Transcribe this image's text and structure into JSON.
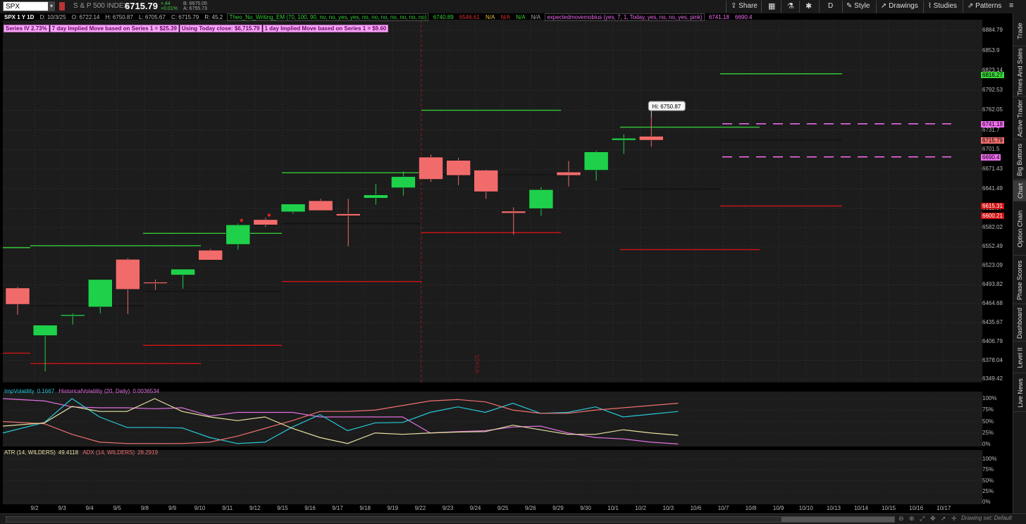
{
  "toolbar": {
    "symbol": "SPX",
    "symbol_name": "S & P 500 INDEX",
    "last_price": "6715.79",
    "change_pts": "+.44",
    "change_pct": "+0.01%",
    "bid": "B: 6675.05",
    "ask": "A: 6755.73",
    "share_label": "Share",
    "aggregation_label": "D",
    "style_label": "Style",
    "drawings_label": "Drawings",
    "studies_label": "Studies",
    "patterns_label": "Patterns"
  },
  "status_line": {
    "title": "SPX 1 Y 1D",
    "date": "D: 10/3/25",
    "open": "O: 6722.14",
    "high": "H: 6750.87",
    "low": "L: 6705.67",
    "close": "C: 6715.79",
    "range": "R: 45.2",
    "study1": "Theo_No_Writing_EM (70, 100, 90, no, no, yes, yes, no, no, no, no, no, no, no)",
    "study1_v1": "6740.89",
    "study1_v2": "6546.61",
    "na1": "N/A",
    "na2": "N/A",
    "na3": "N/A",
    "na4": "N/A",
    "study2": "expectedmovemobius (yes, 7, 1, Today, yes, no, no, yes, pink)",
    "study2_v1": "6741.18",
    "study2_v2": "6690.4"
  },
  "study_labels": {
    "iv": "Series IV 2.73%",
    "seven_day": "7 day Implied Move based on Series 1 = $25.39",
    "close_used": "Using Today close: $6,715.79",
    "one_day": "1 day Implied Move based on Series 1 = $9.60"
  },
  "annotation": {
    "hi_label": "Hi: 6750.87",
    "vline_label": "9/19/25"
  },
  "price_axis": {
    "ticks": [
      "6884.79",
      "6853.9",
      "6823.14",
      "6792.53",
      "6762.05",
      "6731.7",
      "6701.5",
      "6671.43",
      "6641.49",
      "6611.67",
      "6582.02",
      "6552.49",
      "6523.09",
      "6493.82",
      "6464.68",
      "6435.67",
      "6406.79",
      "6378.04",
      "6349.42"
    ],
    "tags": [
      {
        "text": "6816.27",
        "color": "#39d339",
        "fg": "#000"
      },
      {
        "text": "6741.18",
        "color": "#f46ef4",
        "fg": "#000"
      },
      {
        "text": "6715.79",
        "color": "#f07070",
        "fg": "#000"
      },
      {
        "text": "6690.4",
        "color": "#f46ef4",
        "fg": "#000"
      },
      {
        "text": "6615.31",
        "color": "#d01010",
        "fg": "#fff"
      },
      {
        "text": "6600.21",
        "color": "#d01010",
        "fg": "#fff"
      }
    ]
  },
  "vol_legend": {
    "imp_label": "ImpVolatility",
    "imp_value": "0.1667",
    "hist_label": "HistoricalVolatility (20, Daily)",
    "hist_value": "0.0036534"
  },
  "atr_legend": {
    "atr_label": "ATR (14, WILDERS)",
    "atr_value": "49.4118",
    "adx_label": "ADX (14, WILDERS)",
    "adx_value": "28.2919"
  },
  "pct_ticks": [
    "100%",
    "75%",
    "50%",
    "25%",
    "0%"
  ],
  "x_ticks": [
    "9/2",
    "9/3",
    "9/4",
    "9/5",
    "9/8",
    "9/9",
    "9/10",
    "9/11",
    "9/12",
    "9/15",
    "9/16",
    "9/17",
    "9/18",
    "9/19",
    "9/22",
    "9/23",
    "9/24",
    "9/25",
    "9/26",
    "9/29",
    "9/30",
    "10/1",
    "10/2",
    "10/3",
    "10/6",
    "10/7",
    "10/8",
    "10/9",
    "10/10",
    "10/13",
    "10/14",
    "10/15",
    "10/16",
    "10/17"
  ],
  "sidebar_tabs": [
    "Trade",
    "Times And Sales",
    "Active Trader",
    "Big Buttons",
    "Chart",
    "Option Chain",
    "Phase Scores",
    "Dashboard",
    "Level II",
    "Live News"
  ],
  "bottom": {
    "drawing_set": "Drawing set: Default"
  },
  "colors": {
    "up": "#1fd14a",
    "down": "#f26b6b",
    "green_line": "#34c734",
    "red_line": "#d01515",
    "pink": "#f46ef4",
    "bg": "#1c1c1c"
  },
  "chart_data": {
    "type": "candlestick",
    "ylim": [
      6340,
      6895
    ],
    "candles": [
      {
        "d": "9/2",
        "o": 6489,
        "h": 6491,
        "l": 6448,
        "c": 6464
      },
      {
        "d": "9/3",
        "o": 6416,
        "h": 6432,
        "l": 6361,
        "c": 6432
      },
      {
        "d": "9/4",
        "o": 6446,
        "h": 6450,
        "l": 6433,
        "c": 6448
      },
      {
        "d": "9/5",
        "o": 6460,
        "h": 6502,
        "l": 6450,
        "c": 6502
      },
      {
        "d": "9/8",
        "o": 6533,
        "h": 6535,
        "l": 6449,
        "c": 6487
      },
      {
        "d": "9/9",
        "o": 6498,
        "h": 6502,
        "l": 6486,
        "c": 6496
      },
      {
        "d": "9/10",
        "o": 6509,
        "h": 6518,
        "l": 6488,
        "c": 6518
      },
      {
        "d": "9/11",
        "o": 6547,
        "h": 6549,
        "l": 6533,
        "c": 6532
      },
      {
        "d": "9/12",
        "o": 6556,
        "h": 6588,
        "l": 6548,
        "c": 6586
      },
      {
        "d": "9/15",
        "o": 6594,
        "h": 6597,
        "l": 6583,
        "c": 6586
      },
      {
        "d": "9/16",
        "o": 6606,
        "h": 6618,
        "l": 6603,
        "c": 6618
      },
      {
        "d": "9/17",
        "o": 6623,
        "h": 6626,
        "l": 6609,
        "c": 6608
      },
      {
        "d": "9/18",
        "o": 6603,
        "h": 6626,
        "l": 6553,
        "c": 6600
      },
      {
        "d": "9/19",
        "o": 6627,
        "h": 6649,
        "l": 6617,
        "c": 6632
      },
      {
        "d": "9/22",
        "o": 6643,
        "h": 6668,
        "l": 6631,
        "c": 6660
      },
      {
        "d": "9/23",
        "o": 6690,
        "h": 6694,
        "l": 6652,
        "c": 6656
      },
      {
        "d": "9/24",
        "o": 6685,
        "h": 6689,
        "l": 6647,
        "c": 6662
      },
      {
        "d": "9/25",
        "o": 6670,
        "h": 6671,
        "l": 6626,
        "c": 6637
      },
      {
        "d": "9/26",
        "o": 6607,
        "h": 6613,
        "l": 6571,
        "c": 6604
      },
      {
        "d": "9/29",
        "o": 6611,
        "h": 6644,
        "l": 6600,
        "c": 6640
      },
      {
        "d": "9/30",
        "o": 6667,
        "h": 6684,
        "l": 6645,
        "c": 6662
      },
      {
        "d": "10/1",
        "o": 6670,
        "h": 6700,
        "l": 6654,
        "c": 6698
      },
      {
        "d": "10/2",
        "o": 6716,
        "h": 6725,
        "l": 6695,
        "c": 6719
      },
      {
        "d": "10/3",
        "o": 6722,
        "h": 6751,
        "l": 6706,
        "c": 6716
      }
    ]
  }
}
